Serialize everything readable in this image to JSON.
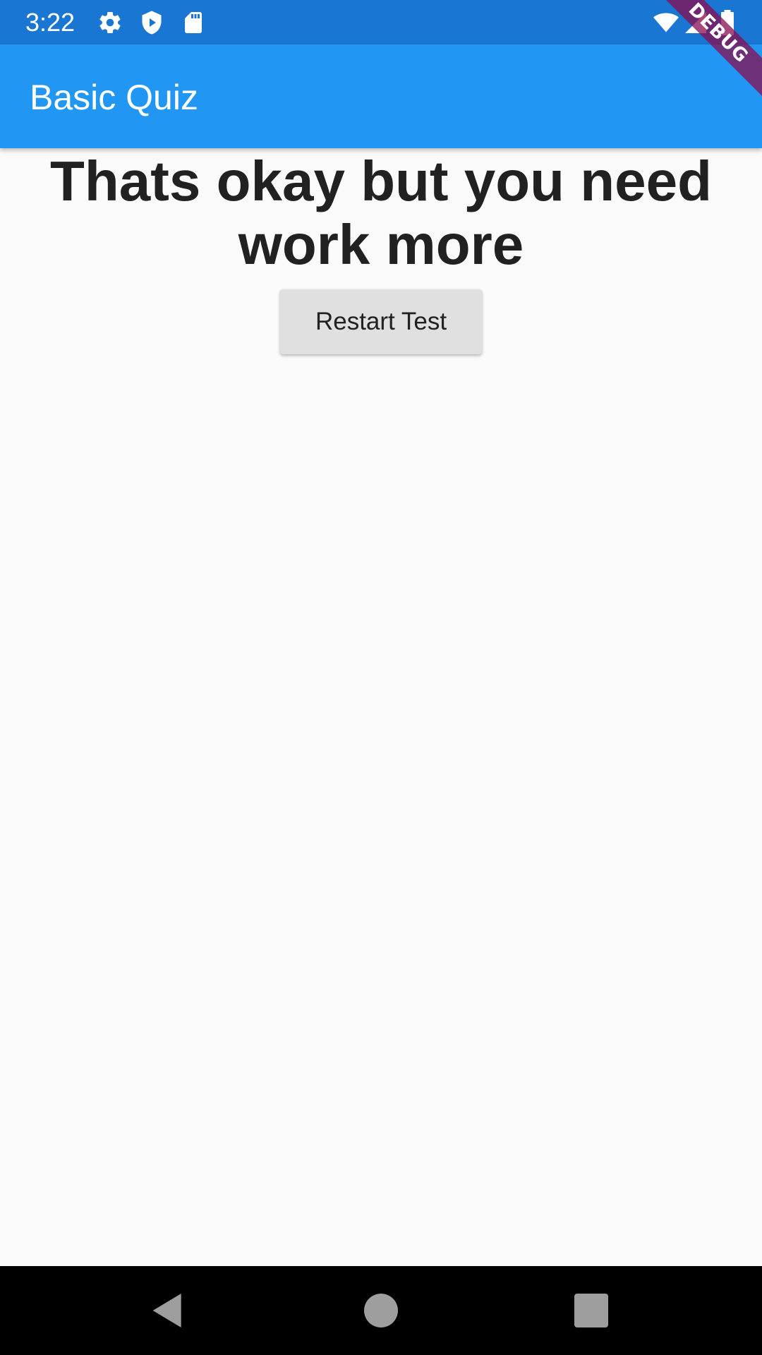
{
  "status_bar": {
    "time": "3:22",
    "left_icons": [
      "gear-icon",
      "play-shield-icon",
      "sd-card-icon"
    ],
    "right_icons": [
      "wifi-icon",
      "cell-signal-icon",
      "battery-icon"
    ]
  },
  "app_bar": {
    "title": "Basic Quiz"
  },
  "debug_banner": {
    "label": "DEBUG"
  },
  "result": {
    "message": "Thats okay but you need work more"
  },
  "actions": {
    "restart_label": "Restart Test"
  },
  "nav_bar": {
    "buttons": [
      "back-icon",
      "home-icon",
      "recents-icon"
    ]
  },
  "colors": {
    "status_bar": "#1976d2",
    "app_bar": "#2196f3",
    "background": "#fafafa",
    "button": "#e0e0e0",
    "text": "#212121",
    "debug_ribbon": "#880e4f"
  }
}
